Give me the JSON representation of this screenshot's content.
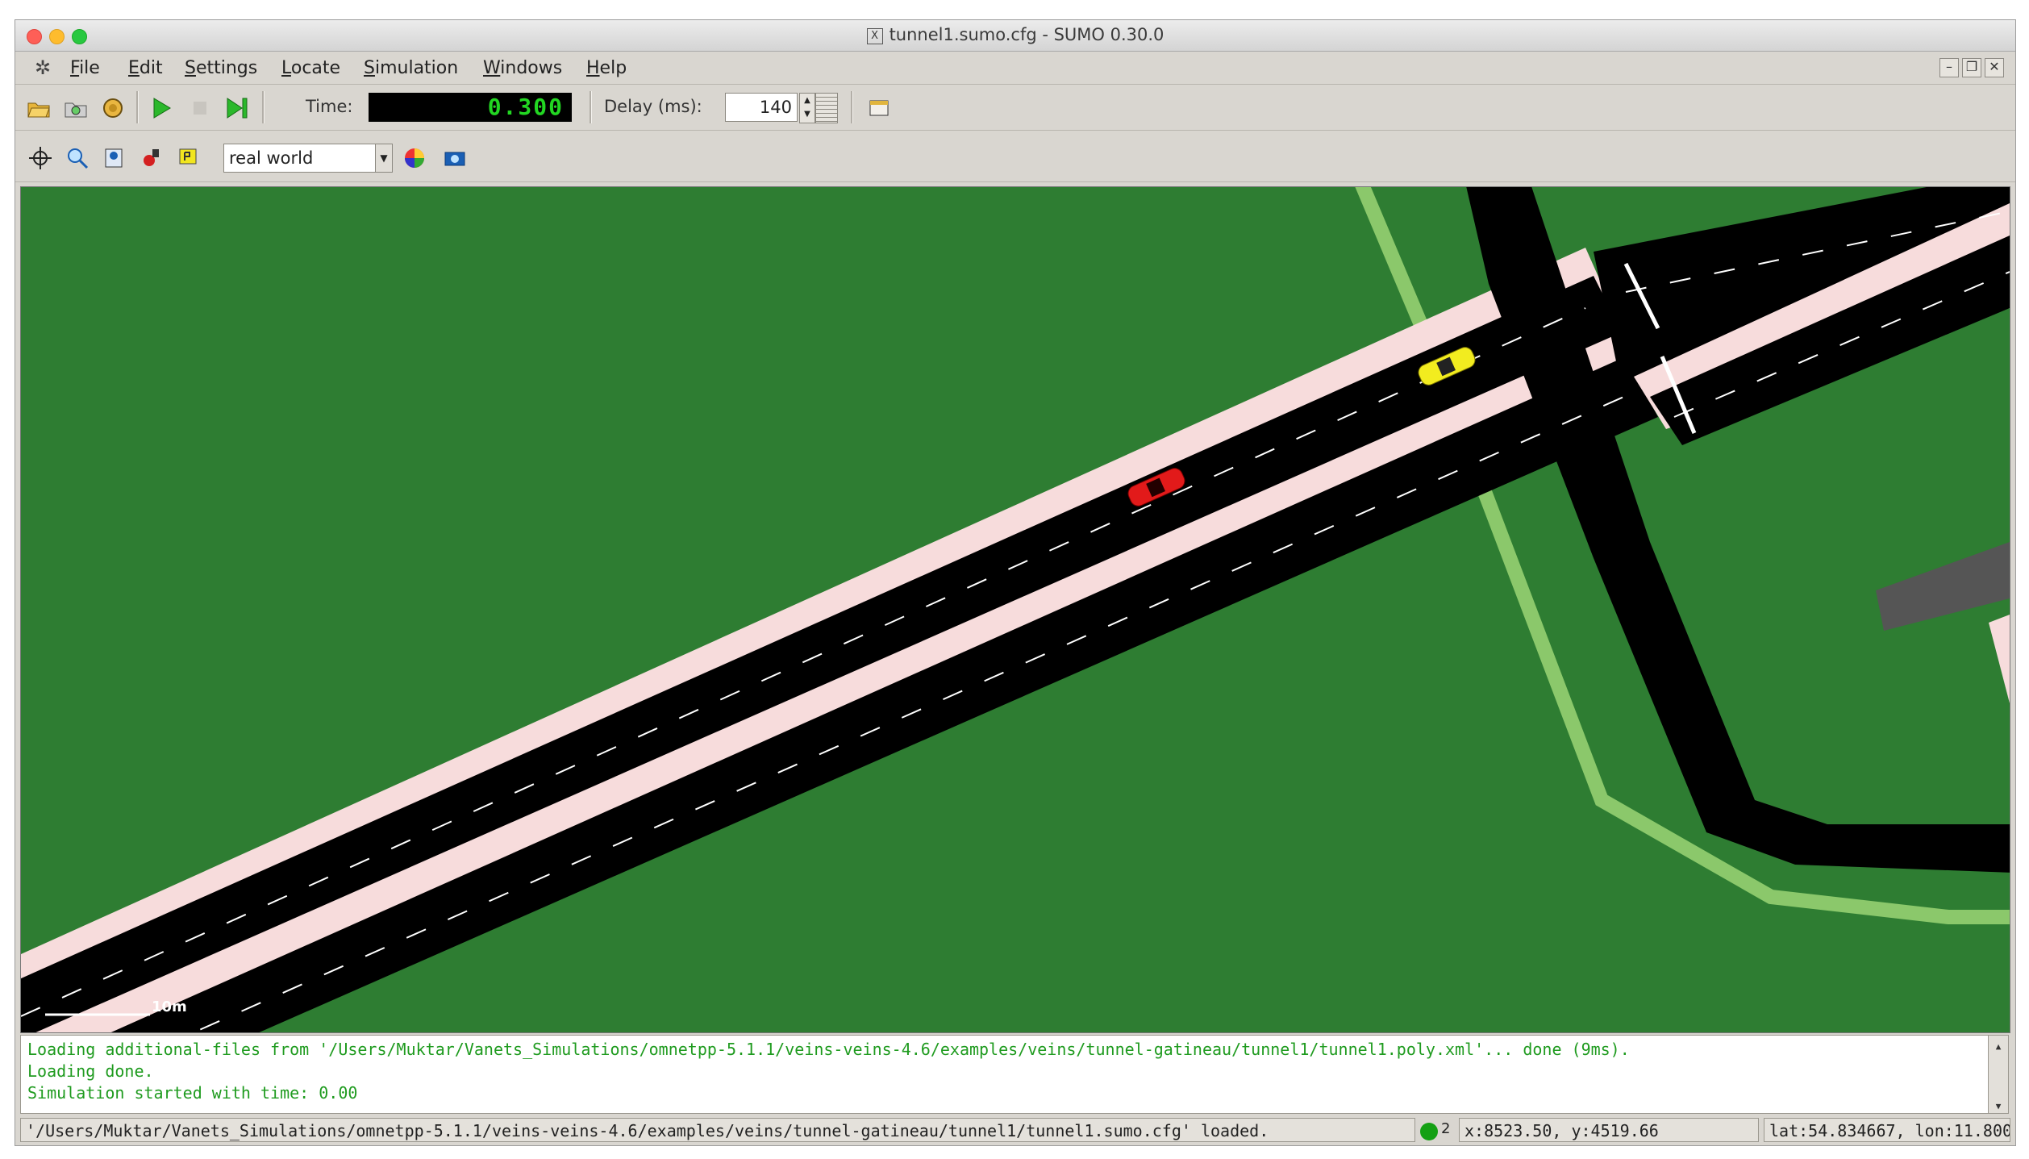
{
  "window": {
    "title": "tunnel1.sumo.cfg - SUMO 0.30.0",
    "x11_badge": "X"
  },
  "menu": {
    "items": [
      "File",
      "Edit",
      "Settings",
      "Locate",
      "Simulation",
      "Windows",
      "Help"
    ],
    "app_icon": "sumo-app-icon"
  },
  "toolbar": {
    "time_label": "Time:",
    "time_value": "0.300",
    "delay_label": "Delay (ms):",
    "delay_value": "140"
  },
  "view_toolbar": {
    "viewport_scheme": "real world"
  },
  "map": {
    "scale_label": "10m"
  },
  "messages": [
    "Loading additional-files from '/Users/Muktar/Vanets_Simulations/omnetpp-5.1.1/veins-veins-4.6/examples/veins/tunnel-gatineau/tunnel1/tunnel1.poly.xml'... done (9ms).",
    "Loading done.",
    "Simulation started with time: 0.00"
  ],
  "status": {
    "file_loaded": "'/Users/Muktar/Vanets_Simulations/omnetpp-5.1.1/veins-veins-4.6/examples/veins/tunnel-gatineau/tunnel1/tunnel1.sumo.cfg' loaded.",
    "vehicle_count": "2",
    "coords_xy": "x:8523.50, y:4519.66",
    "coords_geo": "lat:54.834667, lon:11.800"
  },
  "colors": {
    "grass": "#2e7d32",
    "sidewalk": "#f7dcdc",
    "road": "#000000",
    "path": "#8bc86b",
    "vehicle_red": "#e21a1a",
    "vehicle_yellow": "#f2ec1f",
    "time_display": "#22d622",
    "message_text": "#1f9b1f"
  }
}
